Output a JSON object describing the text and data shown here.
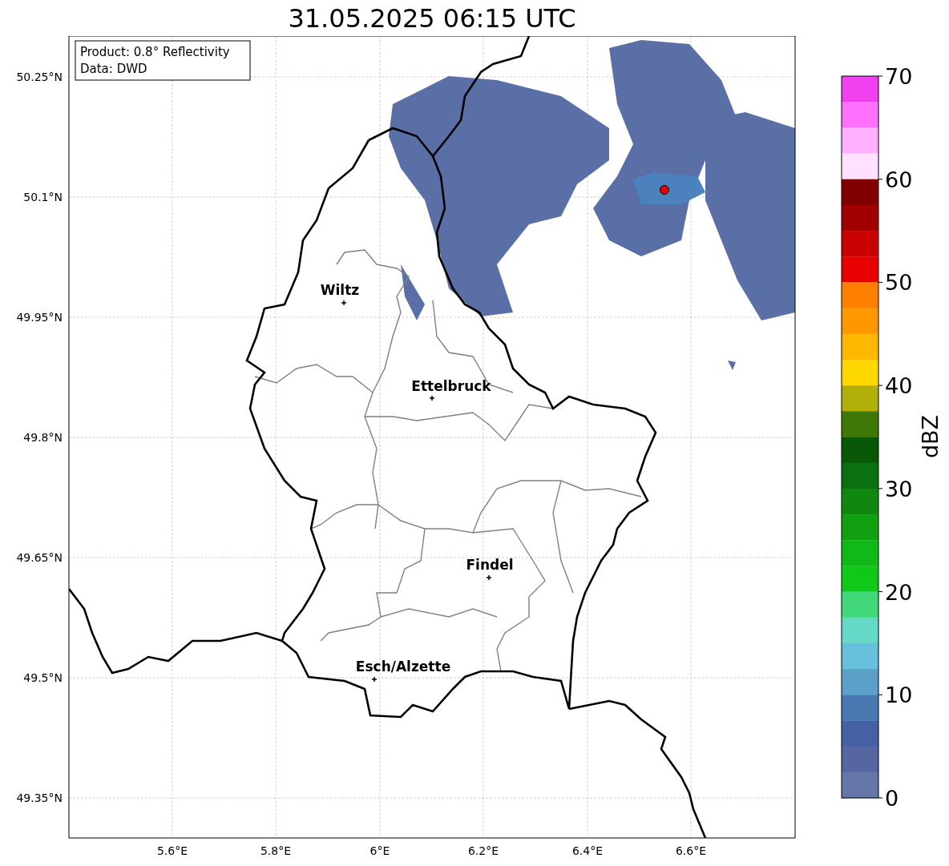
{
  "title": "31.05.2025 06:15 UTC",
  "info_box": [
    "Product: 0.8° Reflectivity",
    "Data: DWD"
  ],
  "y_ticks": [
    "50.25°N",
    "50.1°N",
    "49.95°N",
    "49.8°N",
    "49.65°N",
    "49.5°N",
    "49.35°N"
  ],
  "x_ticks": [
    "5.6°E",
    "5.8°E",
    "6°E",
    "6.2°E",
    "6.4°E",
    "6.6°E"
  ],
  "cities": [
    {
      "name": "Wiltz"
    },
    {
      "name": "Ettelbruck"
    },
    {
      "name": "Findel"
    },
    {
      "name": "Esch/Alzette"
    }
  ],
  "colorbar": {
    "label": "dBZ",
    "ticks": [
      "70",
      "60",
      "50",
      "40",
      "30",
      "20",
      "10",
      "0"
    ],
    "bins": [
      {
        "color": "#f040f0"
      },
      {
        "color": "#ff70ff"
      },
      {
        "color": "#ffb0ff"
      },
      {
        "color": "#ffe0ff"
      },
      {
        "color": "#800000"
      },
      {
        "color": "#a00000"
      },
      {
        "color": "#c80000"
      },
      {
        "color": "#e80000"
      },
      {
        "color": "#ff8000"
      },
      {
        "color": "#ff9800"
      },
      {
        "color": "#ffb800"
      },
      {
        "color": "#ffd800"
      },
      {
        "color": "#b0b008"
      },
      {
        "color": "#407808"
      },
      {
        "color": "#085808"
      },
      {
        "color": "#0a7010"
      },
      {
        "color": "#108810"
      },
      {
        "color": "#10a010"
      },
      {
        "color": "#10b818"
      },
      {
        "color": "#10c818"
      },
      {
        "color": "#40d878"
      },
      {
        "color": "#66d8c8"
      },
      {
        "color": "#66c0dc"
      },
      {
        "color": "#5aa0c8"
      },
      {
        "color": "#4a78b0"
      },
      {
        "color": "#4660a4"
      },
      {
        "color": "#5566a0"
      },
      {
        "color": "#6577a8"
      }
    ]
  }
}
